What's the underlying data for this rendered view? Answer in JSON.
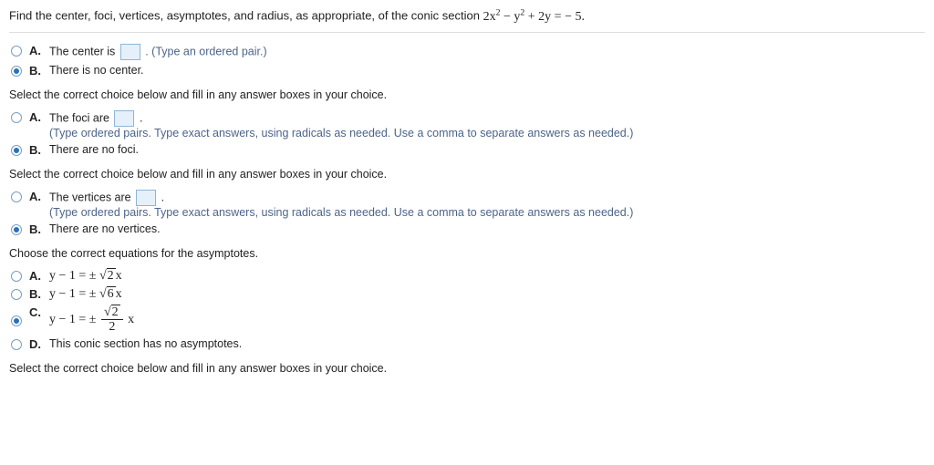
{
  "question": {
    "prefix": "Find the center, foci, vertices, asymptotes, and radius, as appropriate, of the conic section ",
    "eq_lhs": "2x",
    "eq_sq1": "2",
    "eq_mid": " − y",
    "eq_sq2": "2",
    "eq_tail": " + 2y = − 5."
  },
  "group1": {
    "A_text": "The center is ",
    "A_hint": ". (Type an ordered pair.)",
    "B_text": "There is no center."
  },
  "instr1": "Select the correct choice below and fill in any answer boxes in your choice.",
  "group2": {
    "A_text": "The foci are ",
    "A_tail": " .",
    "A_hint": "(Type ordered pairs. Type exact answers, using radicals as needed. Use a comma to separate answers as needed.)",
    "B_text": "There are no foci."
  },
  "instr2": "Select the correct choice below and fill in any answer boxes in your choice.",
  "group3": {
    "A_text": "The vertices are ",
    "A_tail": " .",
    "A_hint": "(Type ordered pairs. Type exact answers, using radicals as needed. Use a comma to separate answers as needed.)",
    "B_text": "There are no vertices."
  },
  "asym_header": "Choose the correct equations for the asymptotes.",
  "asym": {
    "A_pre": "y − 1 = ± ",
    "A_root": "2",
    "A_post": "x",
    "B_pre": "y − 1 = ± ",
    "B_root": "6",
    "B_post": "x",
    "C_pre": "y − 1 = ± ",
    "C_num_root": "2",
    "C_den": "2",
    "C_post": " x",
    "D_text": "This conic section has no asymptotes."
  },
  "instr3": "Select the correct choice below and fill in any answer boxes in your choice.",
  "labels": {
    "A": "A.",
    "B": "B.",
    "C": "C.",
    "D": "D."
  }
}
